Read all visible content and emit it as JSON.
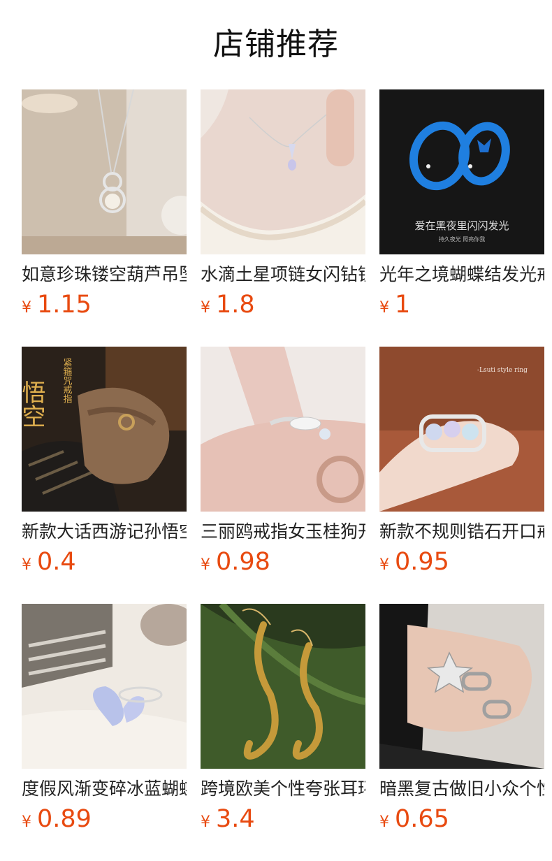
{
  "page": {
    "title": "店铺推荐"
  },
  "colors": {
    "price": "#e84a10",
    "title": "#111111"
  },
  "products": [
    {
      "name": "如意珍珠镂空葫芦吊坠项链",
      "currency": "¥",
      "price": "1.15",
      "image": "pearl-gourd-necklace"
    },
    {
      "name": "水滴土星项链女闪钻锁骨链",
      "currency": "¥",
      "price": "1.8",
      "image": "water-drop-necklace"
    },
    {
      "name": "光年之境蝴蝶结发光戒指",
      "currency": "¥",
      "price": "1",
      "image": "glow-bow-ring",
      "image_text": [
        "爱在黑夜里闪闪发光",
        "持久夜光 照亮你我"
      ]
    },
    {
      "name": "新款大话西游记孙悟空紧箍咒戒指",
      "currency": "¥",
      "price": "0.4",
      "image": "wukong-ring",
      "image_text": [
        "悟空",
        "紧箍咒戒指"
      ]
    },
    {
      "name": "三丽鸥戒指女玉桂狗开口戒",
      "currency": "¥",
      "price": "0.98",
      "image": "cinnamoroll-ring"
    },
    {
      "name": "新款不规则锆石开口戒指",
      "currency": "¥",
      "price": "0.95",
      "image": "moonstone-ring",
      "image_text": [
        "-Lsuti style ring"
      ]
    },
    {
      "name": "度假风渐变碎冰蓝蝴蝶戒指",
      "currency": "¥",
      "price": "0.89",
      "image": "butterfly-ring"
    },
    {
      "name": "跨境欧美个性夸张耳环",
      "currency": "¥",
      "price": "3.4",
      "image": "snake-earrings"
    },
    {
      "name": "暗黑复古做旧小众个性戒指",
      "currency": "¥",
      "price": "0.65",
      "image": "star-rings"
    }
  ]
}
